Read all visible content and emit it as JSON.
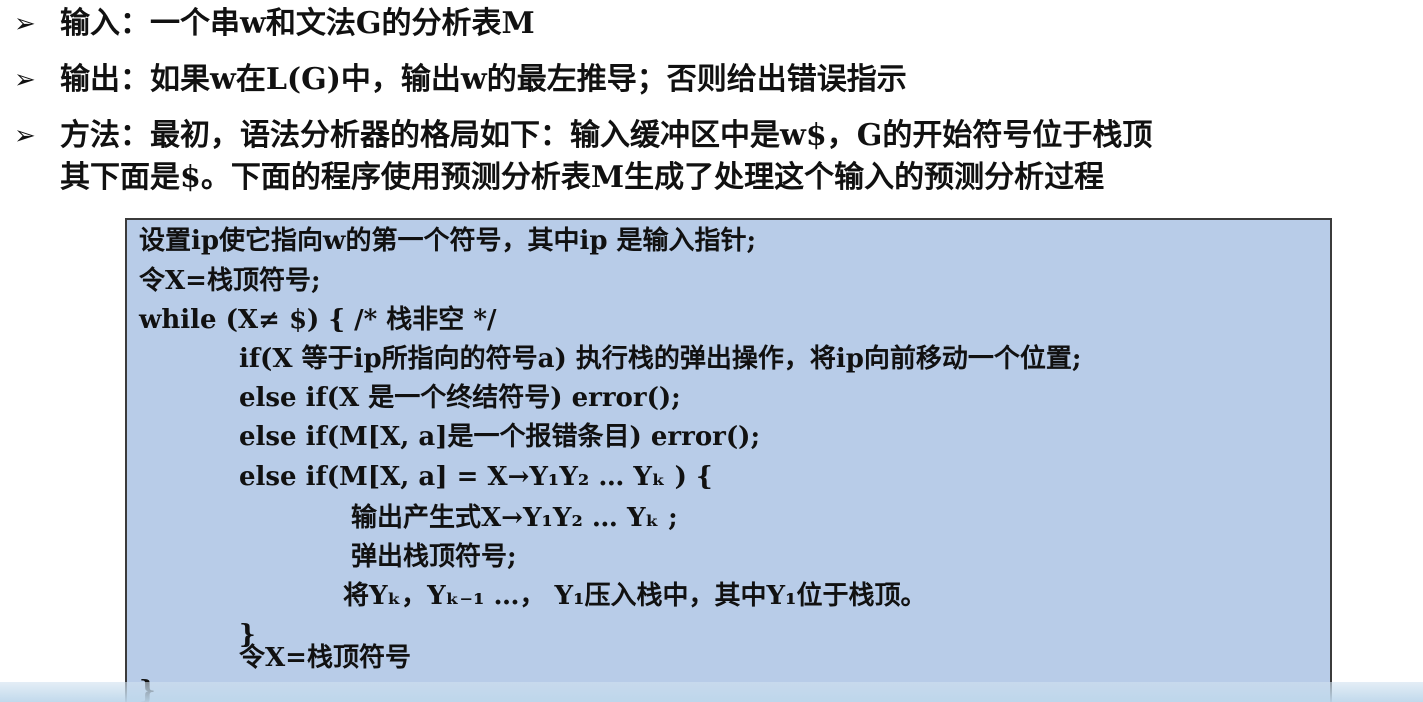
{
  "bullets": [
    {
      "marker": "➢",
      "text": "输入：一个串w和文法G的分析表M"
    },
    {
      "marker": "➢",
      "text": "输出：如果w在L(G)中，输出w的最左推导；否则给出错误指示"
    },
    {
      "marker": "➢",
      "text": "方法：最初，语法分析器的格局如下：输入缓冲区中是w$，G的开始符号位于栈顶"
    }
  ],
  "bullet3_continuation": "其下面是$。下面的程序使用预测分析表M生成了处理这个输入的预测分析过程",
  "code": [
    "设置ip使它指向w的第一个符号，其中ip 是输入指针;",
    "令X=栈顶符号;",
    "while (X≠ $) {    /* 栈非空 */",
    "if(X 等于ip所指向的符号a) 执行栈的弹出操作，将ip向前移动一个位置;",
    "else if(X 是一个终结符号) error();",
    "else if(M[X, a]是一个报错条目) error();",
    "else if(M[X, a] = X→Y₁Y₂ … Yₖ ) {",
    "输出产生式X→Y₁Y₂ … Yₖ ;",
    "弹出栈顶符号;",
    "将Yₖ，Yₖ₋₁ …， Y₁压入栈中，其中Y₁位于栈顶。",
    "}",
    "令X=栈顶符号",
    "}"
  ],
  "colors": {
    "code_background": "#b8cce8",
    "code_border": "#3b3b3b",
    "text": "#111111"
  }
}
